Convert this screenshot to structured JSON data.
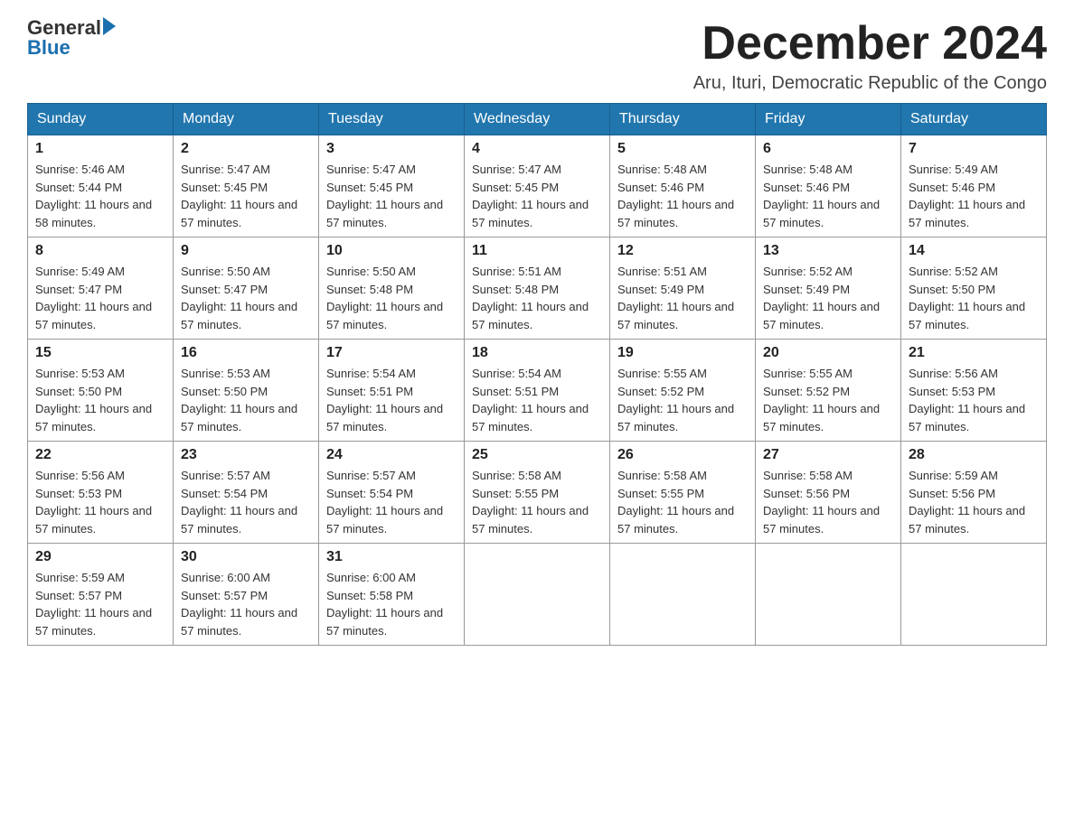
{
  "logo": {
    "general": "General",
    "blue": "Blue"
  },
  "title": {
    "month_year": "December 2024",
    "location": "Aru, Ituri, Democratic Republic of the Congo"
  },
  "headers": [
    "Sunday",
    "Monday",
    "Tuesday",
    "Wednesday",
    "Thursday",
    "Friday",
    "Saturday"
  ],
  "weeks": [
    [
      {
        "day": "1",
        "sunrise": "Sunrise: 5:46 AM",
        "sunset": "Sunset: 5:44 PM",
        "daylight": "Daylight: 11 hours and 58 minutes."
      },
      {
        "day": "2",
        "sunrise": "Sunrise: 5:47 AM",
        "sunset": "Sunset: 5:45 PM",
        "daylight": "Daylight: 11 hours and 57 minutes."
      },
      {
        "day": "3",
        "sunrise": "Sunrise: 5:47 AM",
        "sunset": "Sunset: 5:45 PM",
        "daylight": "Daylight: 11 hours and 57 minutes."
      },
      {
        "day": "4",
        "sunrise": "Sunrise: 5:47 AM",
        "sunset": "Sunset: 5:45 PM",
        "daylight": "Daylight: 11 hours and 57 minutes."
      },
      {
        "day": "5",
        "sunrise": "Sunrise: 5:48 AM",
        "sunset": "Sunset: 5:46 PM",
        "daylight": "Daylight: 11 hours and 57 minutes."
      },
      {
        "day": "6",
        "sunrise": "Sunrise: 5:48 AM",
        "sunset": "Sunset: 5:46 PM",
        "daylight": "Daylight: 11 hours and 57 minutes."
      },
      {
        "day": "7",
        "sunrise": "Sunrise: 5:49 AM",
        "sunset": "Sunset: 5:46 PM",
        "daylight": "Daylight: 11 hours and 57 minutes."
      }
    ],
    [
      {
        "day": "8",
        "sunrise": "Sunrise: 5:49 AM",
        "sunset": "Sunset: 5:47 PM",
        "daylight": "Daylight: 11 hours and 57 minutes."
      },
      {
        "day": "9",
        "sunrise": "Sunrise: 5:50 AM",
        "sunset": "Sunset: 5:47 PM",
        "daylight": "Daylight: 11 hours and 57 minutes."
      },
      {
        "day": "10",
        "sunrise": "Sunrise: 5:50 AM",
        "sunset": "Sunset: 5:48 PM",
        "daylight": "Daylight: 11 hours and 57 minutes."
      },
      {
        "day": "11",
        "sunrise": "Sunrise: 5:51 AM",
        "sunset": "Sunset: 5:48 PM",
        "daylight": "Daylight: 11 hours and 57 minutes."
      },
      {
        "day": "12",
        "sunrise": "Sunrise: 5:51 AM",
        "sunset": "Sunset: 5:49 PM",
        "daylight": "Daylight: 11 hours and 57 minutes."
      },
      {
        "day": "13",
        "sunrise": "Sunrise: 5:52 AM",
        "sunset": "Sunset: 5:49 PM",
        "daylight": "Daylight: 11 hours and 57 minutes."
      },
      {
        "day": "14",
        "sunrise": "Sunrise: 5:52 AM",
        "sunset": "Sunset: 5:50 PM",
        "daylight": "Daylight: 11 hours and 57 minutes."
      }
    ],
    [
      {
        "day": "15",
        "sunrise": "Sunrise: 5:53 AM",
        "sunset": "Sunset: 5:50 PM",
        "daylight": "Daylight: 11 hours and 57 minutes."
      },
      {
        "day": "16",
        "sunrise": "Sunrise: 5:53 AM",
        "sunset": "Sunset: 5:50 PM",
        "daylight": "Daylight: 11 hours and 57 minutes."
      },
      {
        "day": "17",
        "sunrise": "Sunrise: 5:54 AM",
        "sunset": "Sunset: 5:51 PM",
        "daylight": "Daylight: 11 hours and 57 minutes."
      },
      {
        "day": "18",
        "sunrise": "Sunrise: 5:54 AM",
        "sunset": "Sunset: 5:51 PM",
        "daylight": "Daylight: 11 hours and 57 minutes."
      },
      {
        "day": "19",
        "sunrise": "Sunrise: 5:55 AM",
        "sunset": "Sunset: 5:52 PM",
        "daylight": "Daylight: 11 hours and 57 minutes."
      },
      {
        "day": "20",
        "sunrise": "Sunrise: 5:55 AM",
        "sunset": "Sunset: 5:52 PM",
        "daylight": "Daylight: 11 hours and 57 minutes."
      },
      {
        "day": "21",
        "sunrise": "Sunrise: 5:56 AM",
        "sunset": "Sunset: 5:53 PM",
        "daylight": "Daylight: 11 hours and 57 minutes."
      }
    ],
    [
      {
        "day": "22",
        "sunrise": "Sunrise: 5:56 AM",
        "sunset": "Sunset: 5:53 PM",
        "daylight": "Daylight: 11 hours and 57 minutes."
      },
      {
        "day": "23",
        "sunrise": "Sunrise: 5:57 AM",
        "sunset": "Sunset: 5:54 PM",
        "daylight": "Daylight: 11 hours and 57 minutes."
      },
      {
        "day": "24",
        "sunrise": "Sunrise: 5:57 AM",
        "sunset": "Sunset: 5:54 PM",
        "daylight": "Daylight: 11 hours and 57 minutes."
      },
      {
        "day": "25",
        "sunrise": "Sunrise: 5:58 AM",
        "sunset": "Sunset: 5:55 PM",
        "daylight": "Daylight: 11 hours and 57 minutes."
      },
      {
        "day": "26",
        "sunrise": "Sunrise: 5:58 AM",
        "sunset": "Sunset: 5:55 PM",
        "daylight": "Daylight: 11 hours and 57 minutes."
      },
      {
        "day": "27",
        "sunrise": "Sunrise: 5:58 AM",
        "sunset": "Sunset: 5:56 PM",
        "daylight": "Daylight: 11 hours and 57 minutes."
      },
      {
        "day": "28",
        "sunrise": "Sunrise: 5:59 AM",
        "sunset": "Sunset: 5:56 PM",
        "daylight": "Daylight: 11 hours and 57 minutes."
      }
    ],
    [
      {
        "day": "29",
        "sunrise": "Sunrise: 5:59 AM",
        "sunset": "Sunset: 5:57 PM",
        "daylight": "Daylight: 11 hours and 57 minutes."
      },
      {
        "day": "30",
        "sunrise": "Sunrise: 6:00 AM",
        "sunset": "Sunset: 5:57 PM",
        "daylight": "Daylight: 11 hours and 57 minutes."
      },
      {
        "day": "31",
        "sunrise": "Sunrise: 6:00 AM",
        "sunset": "Sunset: 5:58 PM",
        "daylight": "Daylight: 11 hours and 57 minutes."
      },
      null,
      null,
      null,
      null
    ]
  ]
}
